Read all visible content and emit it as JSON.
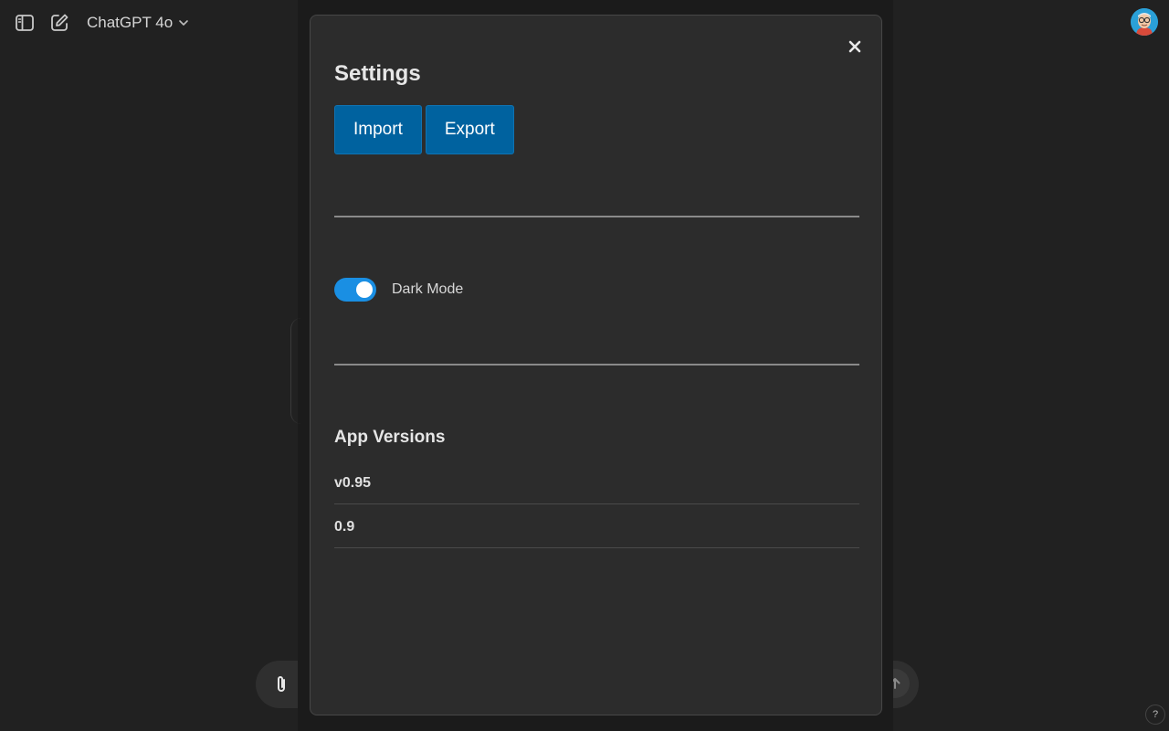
{
  "header": {
    "model_name": "ChatGPT 4o",
    "sidebar_toggle_icon": "sidebar-toggle-icon",
    "new_chat_icon": "new-chat-icon",
    "chevron_icon": "chevron-down-icon",
    "avatar_icon": "avatar"
  },
  "settings": {
    "title": "Settings",
    "close_icon": "close-icon",
    "import_label": "Import",
    "export_label": "Export",
    "dark_mode": {
      "label": "Dark Mode",
      "enabled": true
    },
    "versions_title": "App Versions",
    "versions": [
      "v0.95",
      "0.9"
    ]
  },
  "composer": {
    "attach_icon": "paperclip-icon",
    "send_icon": "arrow-up-icon"
  },
  "help": {
    "label": "?"
  },
  "colors": {
    "background": "#212121",
    "modal": "#2c2c2c",
    "primary_button": "#00629f",
    "toggle_on": "#1a8fe3"
  }
}
